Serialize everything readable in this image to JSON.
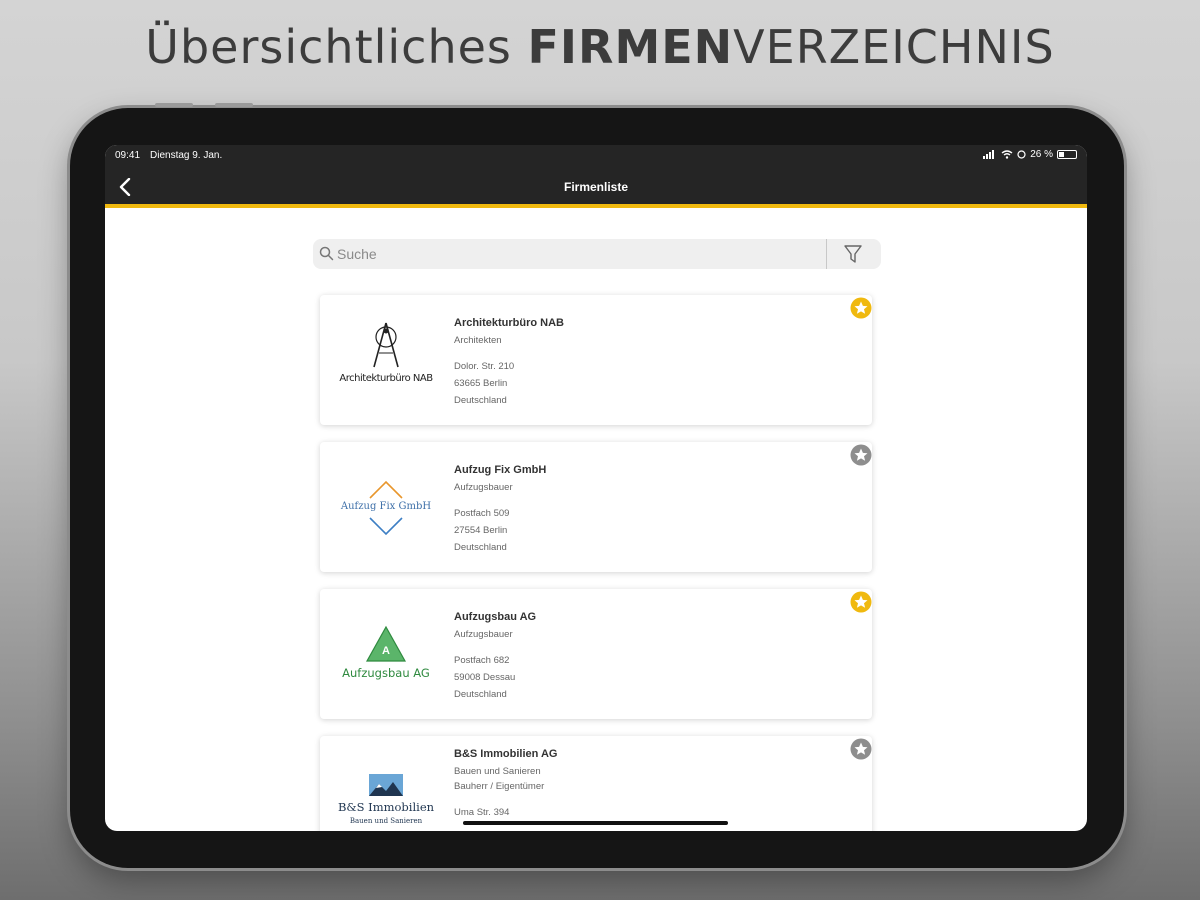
{
  "headline": {
    "regular": "Übersichtliches ",
    "bold": "FIRMEN",
    "rest": "VERZEICHNIS"
  },
  "status_bar": {
    "time": "09:41",
    "date": "Dienstag 9. Jan.",
    "battery": "26 %"
  },
  "nav": {
    "title": "Firmenliste"
  },
  "search": {
    "placeholder": "Suche",
    "value": ""
  },
  "colors": {
    "accent": "#f0b90f",
    "bar": "#252525",
    "star_active": "#f0b90f",
    "star_inactive": "#8e8e8e"
  },
  "companies": [
    {
      "name": "Architekturbüro NAB",
      "categories": [
        "Architekten"
      ],
      "address": [
        "Dolor. Str. 210",
        "63665 Berlin",
        "Deutschland"
      ],
      "logo_text": "Architekturbüro NAB",
      "favorite": true,
      "logo_icon": "compass-icon"
    },
    {
      "name": "Aufzug Fix GmbH",
      "categories": [
        "Aufzugsbauer"
      ],
      "address": [
        "Postfach 509",
        "27554 Berlin",
        "Deutschland"
      ],
      "logo_text": "Aufzug Fix GmbH",
      "favorite": false,
      "logo_icon": "chevron-arrows-icon"
    },
    {
      "name": "Aufzugsbau AG",
      "categories": [
        "Aufzugsbauer"
      ],
      "address": [
        "Postfach 682",
        "59008 Dessau",
        "Deutschland"
      ],
      "logo_text": "Aufzugsbau AG",
      "logo_mark": "A",
      "favorite": true,
      "logo_icon": "triangle-icon"
    },
    {
      "name": "B&S Immobilien AG",
      "categories": [
        "Bauen und Sanieren",
        "Bauherr / Eigentümer"
      ],
      "address": [
        "Uma Str. 394"
      ],
      "logo_text": "B&S Immobilien",
      "logo_subtext": "Bauen und Sanieren",
      "favorite": false,
      "logo_icon": "landscape-icon"
    }
  ]
}
